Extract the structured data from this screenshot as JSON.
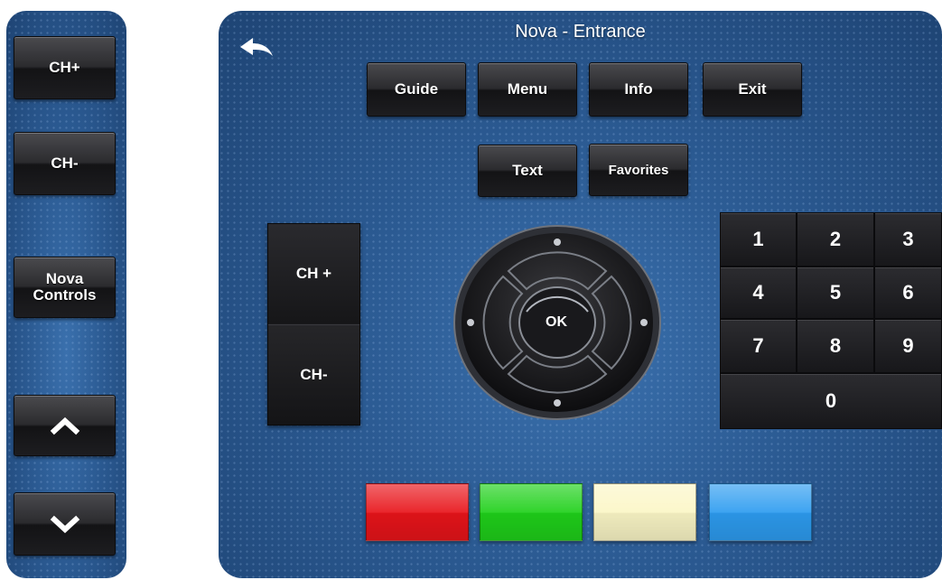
{
  "left_panel": {
    "ch_up": "CH+",
    "ch_down": "CH-",
    "nova_line1": "Nova",
    "nova_line2": "Controls",
    "up_icon": "chevron-up-icon",
    "down_icon": "chevron-down-icon"
  },
  "header": {
    "title": "Nova - Entrance",
    "back_icon": "back-arrow-icon"
  },
  "menu_buttons": {
    "guide": "Guide",
    "menu": "Menu",
    "info": "Info",
    "exit": "Exit",
    "text": "Text",
    "favorites": "Favorites"
  },
  "channel": {
    "up": "CH +",
    "down": "CH-"
  },
  "dpad": {
    "ok": "OK"
  },
  "keypad": {
    "keys": [
      "1",
      "2",
      "3",
      "4",
      "5",
      "6",
      "7",
      "8",
      "9",
      "0"
    ]
  },
  "colors": {
    "red": "#e8141a",
    "green": "#1fd01a",
    "yellow": "#fbf6c6",
    "blue": "#2d9cf0"
  }
}
